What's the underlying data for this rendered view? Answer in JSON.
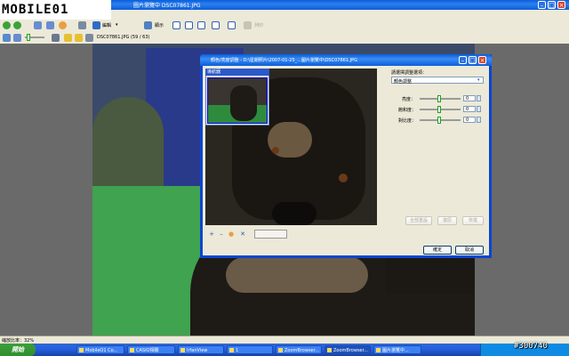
{
  "app": {
    "title": "圖片瀏覽中 DSC07861.JPG",
    "logo_text": "MOBILE01"
  },
  "menu": [
    "",
    "",
    "",
    "",
    "",
    ""
  ],
  "toolbar": {
    "edit_label": "編輯",
    "view_label": "顯示",
    "print_label": "列印"
  },
  "toolbar2": {
    "file_info": "DSC07861.JPG (59 / 63)"
  },
  "dialog": {
    "title": "顏色/亮度調整 - D:\\星期照片\\2007-01-25_...圖片瀏覽中\\DSC07861.JPG",
    "navigator_label": "導航器",
    "section_label": "請選擇調整選項：",
    "dropdown_value": "顏色調整",
    "sliders": [
      {
        "label": "亮度：",
        "value": "0"
      },
      {
        "label": "飽和度：",
        "value": "0"
      },
      {
        "label": "對比度：",
        "value": "0"
      }
    ],
    "reset_all_label": "全部重設",
    "undo_label": "復原",
    "redo_label": "恢復",
    "ok_label": "確定",
    "cancel_label": "取消"
  },
  "status": {
    "zoom_text": "縮放比率：32%"
  },
  "taskbar": {
    "start_label": "開始",
    "tasks": [
      "MobileO1 Co...",
      "CASIO相關",
      "IrfanView",
      "1",
      "ZoomBrowser...",
      "ZoomBrowser...",
      "圖片瀏覽中..."
    ],
    "watermark": "#300740"
  },
  "colors": {
    "title_blue": "#0A5FD8",
    "taskbar_blue": "#245EDC",
    "start_green": "#3C9F3C",
    "close_red": "#D8432A"
  }
}
